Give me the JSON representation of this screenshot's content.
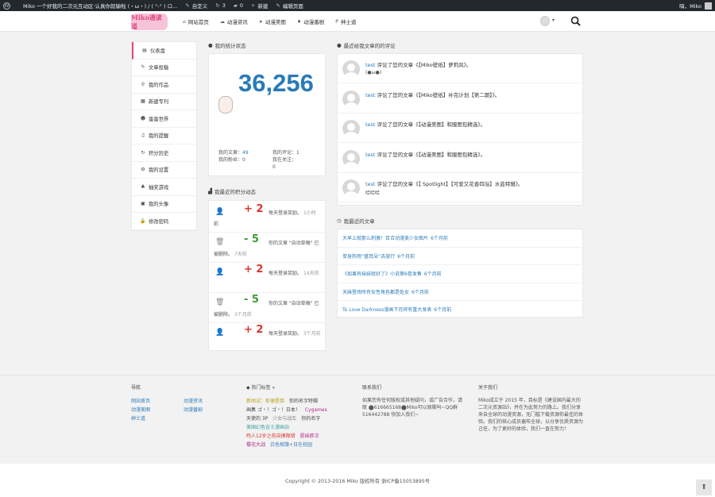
{
  "adminbar": {
    "site_title": "Miko 一个好我的二次元互动区·认真你就输啦 (・ω・) / ( °-° ) ロ...",
    "customize": "自定义",
    "updates_count": "3",
    "comments_count": "0",
    "new_label": "新建",
    "edit_label": "编辑页面",
    "greeting": "嗨，Miko"
  },
  "header": {
    "logo_text": "Miko通读道",
    "nav": [
      {
        "label": "网站首页",
        "icon": "home-icon",
        "glyph": "⌂"
      },
      {
        "label": "动漫资讯",
        "icon": "cloud-icon",
        "glyph": "☁"
      },
      {
        "label": "动漫美图",
        "icon": "send-icon",
        "glyph": "➤"
      },
      {
        "label": "动漫番剧",
        "icon": "gift-icon",
        "glyph": "♦"
      },
      {
        "label": "绅士道",
        "icon": "parking-icon",
        "glyph": "P"
      }
    ]
  },
  "sidebar": {
    "items": [
      {
        "label": "仪表盘",
        "glyph": "▤"
      },
      {
        "label": "文章投稿",
        "glyph": "✎"
      },
      {
        "label": "我的作品",
        "glyph": "⚲"
      },
      {
        "label": "新建专刊",
        "glyph": "▦"
      },
      {
        "label": "蛋蛋世界",
        "glyph": "☻"
      },
      {
        "label": "我的提醒",
        "glyph": "♫"
      },
      {
        "label": "积分历史",
        "glyph": "↻"
      },
      {
        "label": "我的设置",
        "glyph": "⚙"
      },
      {
        "label": "抽奖游戏",
        "glyph": "♣"
      },
      {
        "label": "我的头像",
        "glyph": "▣"
      },
      {
        "label": "修改密码",
        "glyph": "🔒"
      }
    ]
  },
  "stats": {
    "title": "我的统计状态",
    "big_number": "36,256",
    "articles_label": "我的文章：",
    "articles": "49",
    "comments_label": "我的评论：",
    "comments": "1",
    "followers_label": "我的粉丝：",
    "followers": "0",
    "following_label": "我在关注：",
    "following": "0"
  },
  "points": {
    "title": "我最近的积分动态",
    "rows": [
      {
        "icon": "user-icon",
        "points": "+ 2",
        "type": "plus",
        "desc": "每天登录奖励。",
        "time": "1小时",
        "line2": "前",
        "line2_time": ""
      },
      {
        "icon": "trash-icon",
        "points": "- 5",
        "type": "minus",
        "desc": "你的文章 \"自动草稿\" 已",
        "time": "",
        "line2": "被删除。",
        "line2_time": "7天前"
      },
      {
        "icon": "user-icon",
        "points": "+ 2",
        "type": "plus",
        "desc": "每天登录奖励。",
        "time": "14天前",
        "line2": "",
        "line2_time": ""
      },
      {
        "icon": "trash-icon",
        "points": "- 5",
        "type": "minus",
        "desc": "你的文章 \"自动草稿\" 已",
        "time": "",
        "line2": "被删除。",
        "line2_time": "3个月前"
      },
      {
        "icon": "user-icon",
        "points": "+ 2",
        "type": "plus",
        "desc": "每天登录奖励。",
        "time": "3个月前",
        "line2": "",
        "line2_time": ""
      }
    ]
  },
  "comments": {
    "title": "最近给我文章的的评论",
    "rows": [
      {
        "user": "test",
        "text": "评论了您的文章《【Miko壁纸】萝莉风》。",
        "sub": "(●ω●)"
      },
      {
        "user": "test",
        "text": "评论了您的文章《【Miko壁纸】补完计划【第二期】》。",
        "sub": ""
      },
      {
        "user": "test",
        "text": "评论了您的文章《【动漫美图】和服图包精选》。",
        "sub": ""
      },
      {
        "user": "test",
        "text": "评论了您的文章《【动漫美图】和服图包精选》。",
        "sub": ""
      },
      {
        "user": "test",
        "text": "评论了您的文章《【 Spotlight】【可爱又花香四溢】水蓝特辑》。",
        "sub": "哈哈哈"
      }
    ]
  },
  "recent_posts": {
    "title": "我最近的文章",
    "rows": [
      {
        "title": "大早上就那么刺激！百合动漫美少女图片",
        "date": "6个月前"
      },
      {
        "title": "单身狗用“盛耳朵”去旅行",
        "date": "6个月前"
      },
      {
        "title": "《如果有妹妹就好了》小说第6卷发售",
        "date": "6个月前"
      },
      {
        "title": "天麻登场所有女性角色都是处女",
        "date": "6个月前"
      },
      {
        "title": "To Love Darkness漫画下月将有重大发表",
        "date": "6个月前"
      }
    ]
  },
  "footer": {
    "nav_title": "导航",
    "nav_links": [
      "网站首页",
      "动漫资讯",
      "动漫美图",
      "动漫番剧",
      "绅士道"
    ],
    "tags_title": "热门标签 »",
    "tags": [
      {
        "label": "新闻试：即便是我",
        "color": "#b8a020"
      },
      {
        "label": "你的名字特辑",
        "color": "#444"
      },
      {
        "label": "画集 ゴ・！ゴ・！日本！",
        "color": "#444"
      },
      {
        "label": "Cygames",
        "color": "#b02a8a"
      },
      {
        "label": "天使的 3P",
        "color": "#444"
      },
      {
        "label": "少女与战车",
        "color": "#888"
      },
      {
        "label": "你的名字",
        "color": "#444"
      },
      {
        "label": "美国幻色吉士漫画站",
        "color": "#3aa0a0"
      },
      {
        "label": "鸣人12岁之前自摸限错",
        "color": "#d9362c"
      },
      {
        "label": "愿妹胖次",
        "color": "#b02a8a"
      },
      {
        "label": "樱花大战",
        "color": "#b02a8a"
      },
      {
        "label": "白色相簿+日在校园",
        "color": "#3a7ab8"
      }
    ],
    "contact_title": "联系我们",
    "contact_text": "如果您有任何版权或其他疑问，或广告合作，请 联 ⬤616665168⬤Miko可以骑脚吗~QQ群 516442788 快加入我们~",
    "about_title": "关于我们",
    "about_text": "Miko成立于 2015 年，目标是《建设国内最大的二次元资源站》，并在为此努力的路上。我们分享来自全球的动漫资源，无门槛下载资源你最佳的体验。我们的核心成员遍布全球，以分享优质资源为己任，为了更好的体验，我们一直在努力！",
    "copyright": "Copyright © 2013-2016 Miko 版权所有 浙ICP备15053895号"
  },
  "colors": {
    "accent": "#2a7ab8",
    "plus": "#d9362c",
    "minus": "#3d9a3d",
    "active_border": "#e0487e"
  }
}
